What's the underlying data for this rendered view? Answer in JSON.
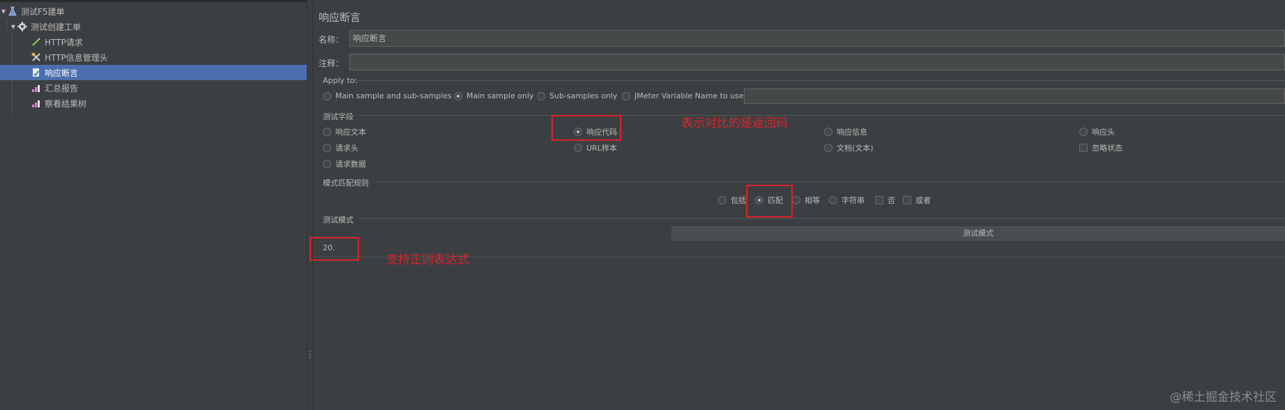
{
  "tree": {
    "items": [
      {
        "label": "测试F5建单",
        "icon": "test-plan-icon"
      },
      {
        "label": "测试创建工单",
        "icon": "thread-group-gear-icon"
      },
      {
        "label": "HTTP请求",
        "icon": "pipette-sampler-icon"
      },
      {
        "label": "HTTP信息管理头",
        "icon": "wrench-config-icon"
      },
      {
        "label": "响应断言",
        "icon": "assertion-icon"
      },
      {
        "label": "汇总报告",
        "icon": "chart-listener-icon"
      },
      {
        "label": "察看结果树",
        "icon": "chart-listener-icon"
      }
    ]
  },
  "panel": {
    "title": "响应断言",
    "name_label": "名称：",
    "name_value": "响应断言",
    "comment_label": "注释：",
    "comment_value": ""
  },
  "apply_to": {
    "title": "Apply to:",
    "options": [
      "Main sample and sub-samples",
      "Main sample only",
      "Sub-samples only",
      "JMeter Variable Name to use"
    ],
    "selected": "Main sample only",
    "variable_value": ""
  },
  "test_field": {
    "title": "测试字段",
    "options": [
      "响应文本",
      "响应代码",
      "响应信息",
      "响应头",
      "请求头",
      "URL样本",
      "文档(文本)",
      "请求数据"
    ],
    "selected": "响应代码",
    "ignore_status_label": "忽略状态"
  },
  "match_rules": {
    "title": "模式匹配规则",
    "radio_options": [
      "包括",
      "匹配",
      "相等",
      "字符串"
    ],
    "selected": "匹配",
    "checkbox_not": "否",
    "checkbox_or": "或者"
  },
  "patterns": {
    "title": "测试模式",
    "column_header": "测试模式",
    "rows": [
      "20."
    ]
  },
  "annotations": {
    "response_code_note": "表示对比的是返回码",
    "regex_note": "支持正则表达式"
  },
  "watermark": "@稀土掘金技术社区",
  "colors": {
    "background": "#3c3f41",
    "selection": "#4b6eaf",
    "annotation_red": "#d8242f",
    "text": "#bbbbbb"
  }
}
